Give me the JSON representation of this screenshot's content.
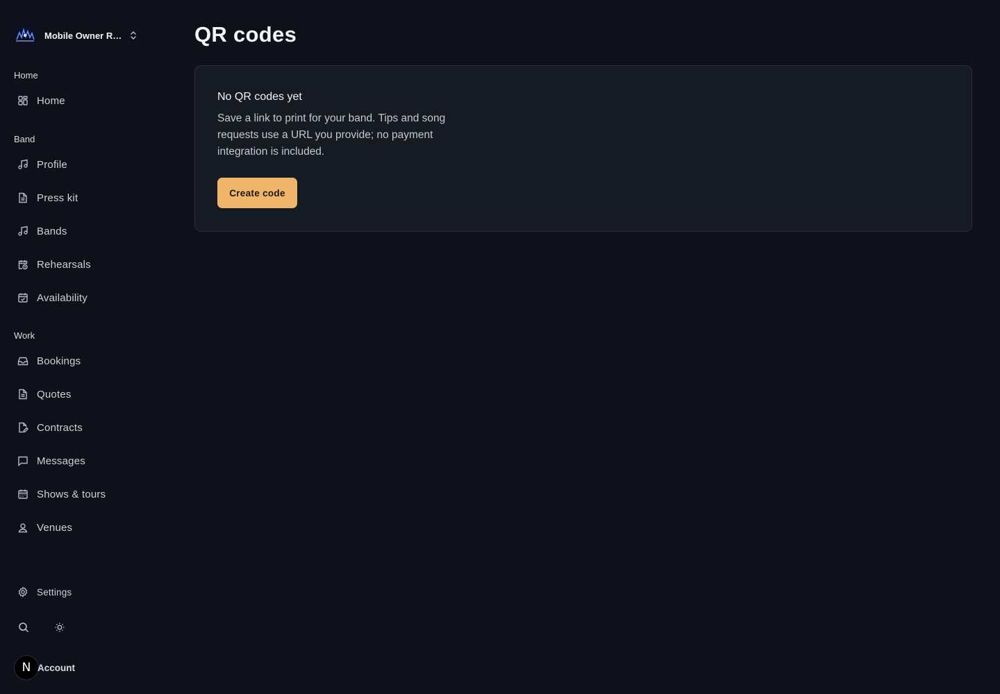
{
  "workspace": {
    "name": "Mobile Owner Re...",
    "logo_icon": "band-logo-icon",
    "switch_icon": "chevron-updown-icon"
  },
  "sidebar": {
    "sections": [
      {
        "label": "Home",
        "items": [
          {
            "label": "Home",
            "icon": "grid-icon"
          }
        ]
      },
      {
        "label": "Band",
        "items": [
          {
            "label": "Profile",
            "icon": "music-note-icon"
          },
          {
            "label": "Press kit",
            "icon": "document-icon"
          },
          {
            "label": "Bands",
            "icon": "music-note-icon"
          },
          {
            "label": "Rehearsals",
            "icon": "calendar-clock-icon"
          },
          {
            "label": "Availability",
            "icon": "calendar-check-icon"
          }
        ]
      },
      {
        "label": "Work",
        "items": [
          {
            "label": "Bookings",
            "icon": "inbox-icon"
          },
          {
            "label": "Quotes",
            "icon": "document-icon"
          },
          {
            "label": "Contracts",
            "icon": "document-edit-icon"
          },
          {
            "label": "Messages",
            "icon": "message-icon"
          },
          {
            "label": "Shows & tours",
            "icon": "calendar-icon"
          },
          {
            "label": "Venues",
            "icon": "map-pin-icon"
          }
        ]
      }
    ],
    "settings_label": "Settings",
    "account": {
      "initial": "N",
      "label": "Account"
    }
  },
  "main": {
    "title": "QR codes",
    "empty_state": {
      "title": "No QR codes yet",
      "text": "Save a link to print for your band. Tips and song requests use a URL you provide; no payment integration is included.",
      "button_label": "Create code"
    }
  },
  "colors": {
    "background": "#0e111a",
    "card": "#161a23",
    "accent": "#efb56b"
  }
}
